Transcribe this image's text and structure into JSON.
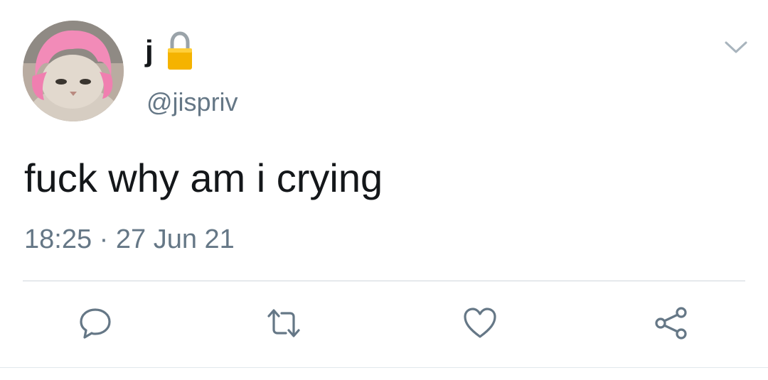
{
  "tweet": {
    "display_name": "j",
    "handle": "@jispriv",
    "text": "fuck why am i crying",
    "time": "18:25",
    "separator": "·",
    "date": "27 Jun 21"
  },
  "icons": {
    "lock": "lock-icon",
    "menu": "chevron-down-icon",
    "reply": "reply-icon",
    "retweet": "retweet-icon",
    "like": "heart-icon",
    "share": "share-icon"
  },
  "colors": {
    "text_primary": "#14171a",
    "text_secondary": "#657786",
    "icon": "#657786",
    "lock_body": "#f5b300",
    "avatar_wig": "#f28bb8"
  }
}
